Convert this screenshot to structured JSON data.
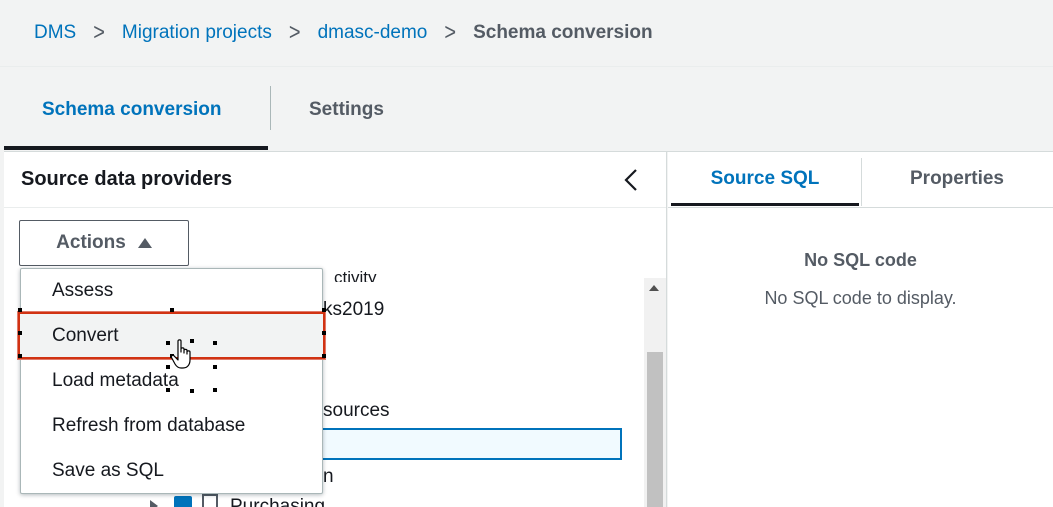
{
  "breadcrumb": {
    "items": [
      "DMS",
      "Migration projects",
      "dmasc-demo"
    ],
    "current": "Schema conversion"
  },
  "tabs": {
    "active": "Schema conversion",
    "settings": "Settings"
  },
  "source_panel": {
    "title": "Source data providers",
    "actions_label": "Actions",
    "tree_behind": {
      "line1": "ctivity",
      "line2": "ks2019",
      "line3": "sources",
      "line4": "n",
      "line5": "Purchasing"
    }
  },
  "actions_menu": {
    "items": [
      "Assess",
      "Convert",
      "Load metadata",
      "Refresh from database",
      "Save as SQL"
    ],
    "highlighted": "Convert"
  },
  "right_panel": {
    "tabs": [
      "Source SQL",
      "Properties"
    ],
    "empty_title": "No SQL code",
    "empty_text": "No SQL code to display."
  },
  "colors": {
    "link": "#0073bb",
    "highlight_border": "#d13212",
    "checkbox": "#0073bb"
  },
  "icons": [
    "chevron-right-icon",
    "chevron-left-icon",
    "caret-up-icon",
    "hand-cursor-icon",
    "document-icon"
  ]
}
